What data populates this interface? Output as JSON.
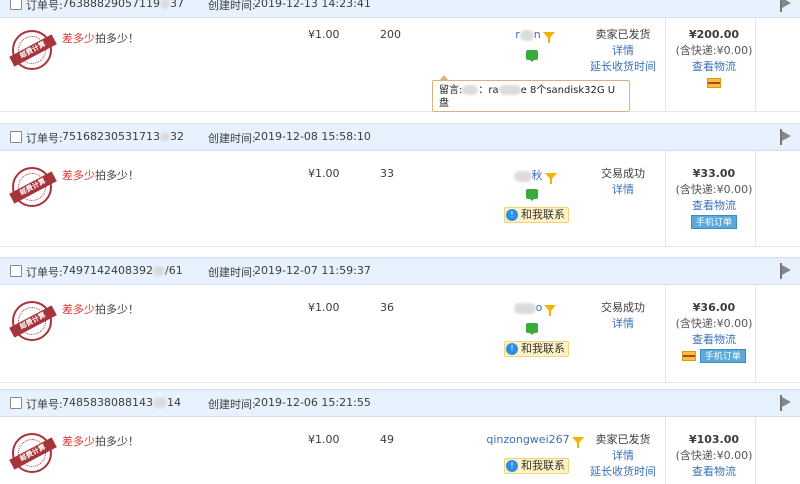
{
  "labels": {
    "order_no": "订单号:",
    "created": "创建时间:",
    "seal_text": "邮费计算"
  },
  "orders": [
    {
      "order_no_start": "76388829057119",
      "order_no_end": "37",
      "created_time": "2019-12-13 14:23:41",
      "title_red": "差多少",
      "title_rest": "拍多少！",
      "price": "¥1.00",
      "quantity": "200",
      "buyer_start": "r",
      "buyer_end": "n",
      "status": "卖家已发货",
      "details": "详情",
      "extend": "延长收货时间",
      "total": "¥200.00",
      "shipping": "(含快递:¥0.00)",
      "logistics": "查看物流"
    },
    {
      "order_no_start": "75168230531713",
      "order_no_end": "32",
      "created_time": "2019-12-08 15:58:10",
      "title_red": "差多少",
      "title_rest": "拍多少！",
      "price": "¥1.00",
      "quantity": "33",
      "buyer_start": "",
      "buyer_end": "秋",
      "contact": "和我联系",
      "status": "交易成功",
      "details": "详情",
      "total": "¥33.00",
      "shipping": "(含快递:¥0.00)",
      "logistics": "查看物流",
      "mobile_order": "手机订单"
    },
    {
      "order_no_start": "7497142408392",
      "order_no_end": "/61",
      "created_time": "2019-12-07 11:59:37",
      "title_red": "差多少",
      "title_rest": "拍多少！",
      "price": "¥1.00",
      "quantity": "36",
      "buyer_start": "",
      "buyer_end": "o",
      "contact": "和我联系",
      "status": "交易成功",
      "details": "详情",
      "total": "¥36.00",
      "shipping": "(含快递:¥0.00)",
      "logistics": "查看物流",
      "mobile_order": "手机订单"
    },
    {
      "order_no_start": "7485838088143",
      "order_no_end": "14",
      "created_time": "2019-12-06 15:21:55",
      "title_red": "差多少",
      "title_rest": "拍多少！",
      "price": "¥1.00",
      "quantity": "49",
      "buyer": "qinzongwei267",
      "contact": "和我联系",
      "status": "卖家已发货",
      "details": "详情",
      "extend": "延长收货时间",
      "total": "¥103.00",
      "shipping": "(含快递:¥0.00)",
      "logistics": "查看物流"
    }
  ],
  "tooltip": {
    "prefix": "留言:",
    "middle": "：ra",
    "suffix": "e 8个sandisk32G U",
    "line2": "盘"
  },
  "colors": {
    "header_bg": "#e8f2ff",
    "link": "#3b6fb8",
    "title_red": "#e0322d",
    "seal": "#a8343b"
  }
}
